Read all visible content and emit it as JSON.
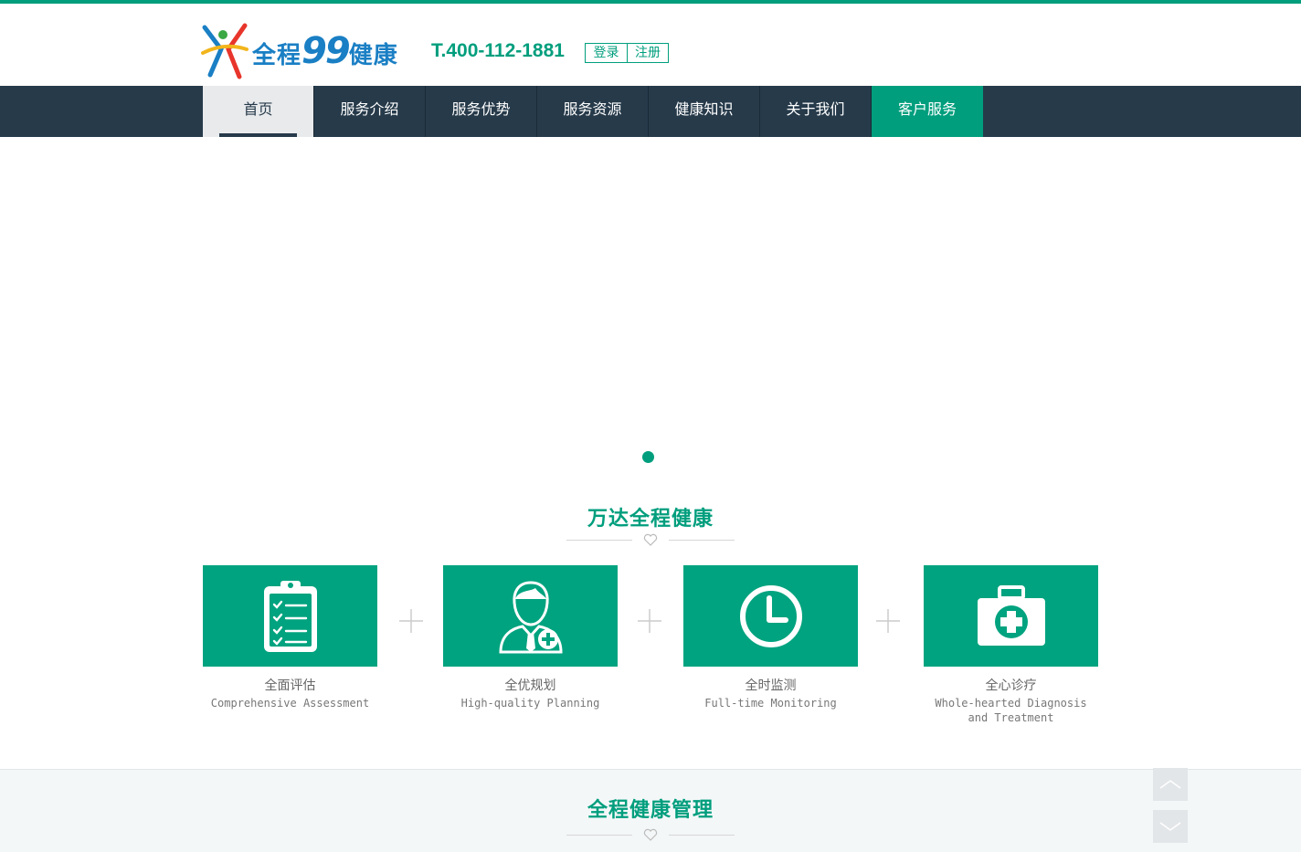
{
  "header": {
    "logo": {
      "text_main": "全程",
      "text_nine": "99",
      "text_end": "健康"
    },
    "phone": "T.400-112-1881",
    "auth": {
      "login": "登录",
      "register": "注册"
    }
  },
  "nav": {
    "items": [
      {
        "label": "首页"
      },
      {
        "label": "服务介绍"
      },
      {
        "label": "服务优势"
      },
      {
        "label": "服务资源"
      },
      {
        "label": "健康知识"
      },
      {
        "label": "关于我们"
      },
      {
        "label": "客户服务"
      }
    ]
  },
  "section1": {
    "title": "万达全程健康",
    "features": [
      {
        "cn": "全面评估",
        "en": "Comprehensive Assessment",
        "icon": "clipboard-checklist-icon"
      },
      {
        "cn": "全优规划",
        "en": "High-quality Planning",
        "icon": "doctor-icon"
      },
      {
        "cn": "全时监测",
        "en": "Full-time Monitoring",
        "icon": "clock-icon"
      },
      {
        "cn": "全心诊疗",
        "en": "Whole-hearted Diagnosis and Treatment",
        "icon": "medical-kit-icon"
      }
    ]
  },
  "section2": {
    "title": "全程健康管理"
  },
  "colors": {
    "accent": "#009e7d",
    "nav_bg": "#263a4a"
  }
}
